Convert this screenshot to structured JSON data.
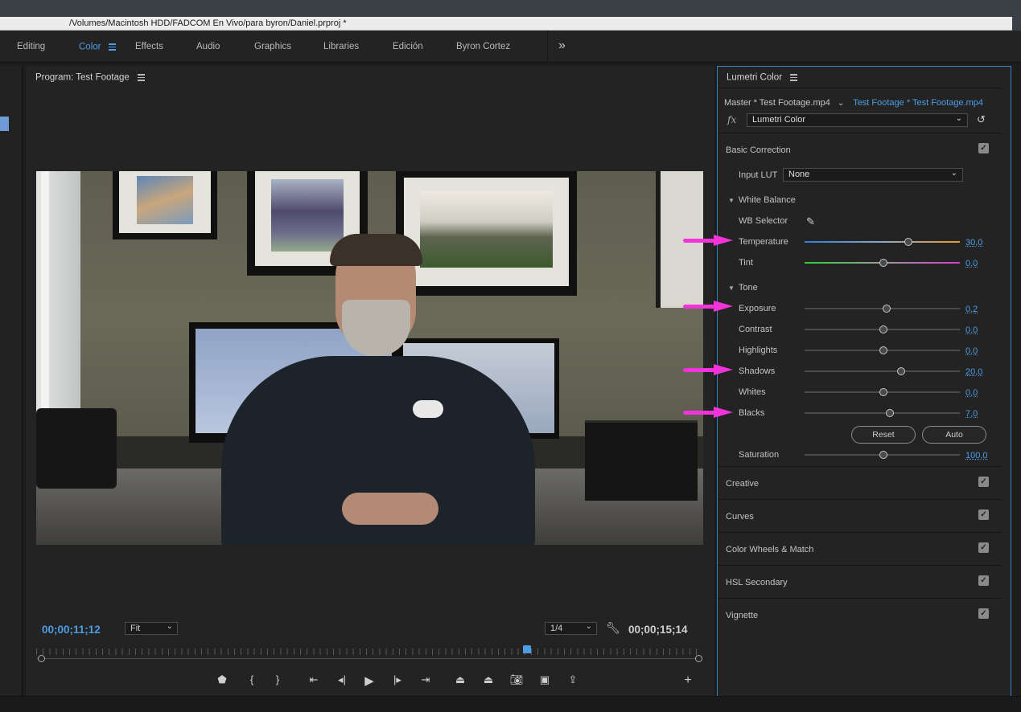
{
  "window": {
    "path": "/Volumes/Macintosh HDD/FADCOM En Vivo/para byron/Daniel.prproj *"
  },
  "workspaces": {
    "items": [
      "Editing",
      "Color",
      "Effects",
      "Audio",
      "Graphics",
      "Libraries",
      "Edición",
      "Byron Cortez"
    ],
    "active": "Color",
    "overflow": "»"
  },
  "program": {
    "title": "Program: Test Footage",
    "timecode_current": "00;00;11;12",
    "timecode_duration": "00;00;15;14",
    "zoom": "Fit",
    "resolution": "1/4",
    "playhead_fraction": 0.74,
    "controls": [
      "marker",
      "in-point",
      "out-point",
      "go-to-in",
      "step-back",
      "play",
      "step-forward",
      "go-to-out",
      "lift",
      "extract",
      "export-frame",
      "comparison-view",
      "button-editor",
      "add"
    ]
  },
  "lumetri": {
    "title": "Lumetri Color",
    "master_clip": "Master * Test Footage.mp4",
    "sequence_clip": "Test Footage * Test Footage.mp4",
    "fx_label": "fx",
    "effect": "Lumetri Color",
    "basic": {
      "title": "Basic Correction",
      "input_lut_label": "Input LUT",
      "input_lut_value": "None",
      "white_balance_title": "White Balance",
      "wb_selector_label": "WB Selector",
      "params_wb": [
        {
          "label": "Temperature",
          "value": "30,0",
          "pos": 0.67
        },
        {
          "label": "Tint",
          "value": "0,0",
          "pos": 0.51
        }
      ],
      "tone_title": "Tone",
      "params_tone": [
        {
          "label": "Exposure",
          "value": "0,2",
          "pos": 0.53
        },
        {
          "label": "Contrast",
          "value": "0,0",
          "pos": 0.51
        },
        {
          "label": "Highlights",
          "value": "0,0",
          "pos": 0.51
        },
        {
          "label": "Shadows",
          "value": "20,0",
          "pos": 0.62
        },
        {
          "label": "Whites",
          "value": "0,0",
          "pos": 0.51
        },
        {
          "label": "Blacks",
          "value": "7,0",
          "pos": 0.55
        }
      ],
      "reset_label": "Reset",
      "auto_label": "Auto",
      "saturation": {
        "label": "Saturation",
        "value": "100,0",
        "pos": 0.51
      }
    },
    "sections": [
      "Creative",
      "Curves",
      "Color Wheels & Match",
      "HSL Secondary",
      "Vignette"
    ]
  },
  "colors": {
    "accent": "#4d9de5",
    "annotation_arrow": "#f233d9"
  }
}
